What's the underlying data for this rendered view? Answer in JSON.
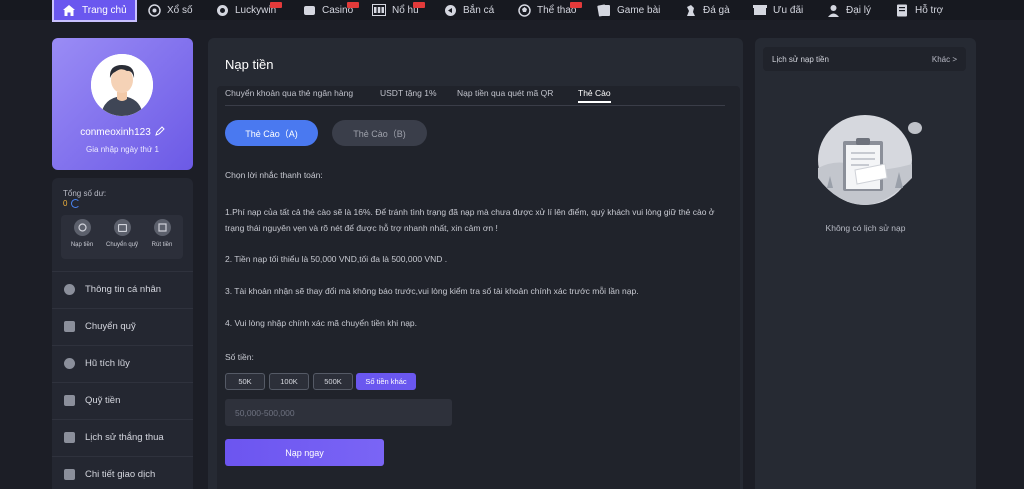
{
  "nav": {
    "items": [
      {
        "label": "Trang chủ",
        "icon": "home-icon",
        "active": true
      },
      {
        "label": "Xổ số",
        "icon": "lottery-icon"
      },
      {
        "label": "Luckywin",
        "icon": "luckywin-icon",
        "badge": true
      },
      {
        "label": "Casino",
        "icon": "casino-icon",
        "badge": true
      },
      {
        "label": "Nổ hũ",
        "icon": "slot-icon",
        "badge": true
      },
      {
        "label": "Bắn cá",
        "icon": "fish-icon"
      },
      {
        "label": "Thể thao",
        "icon": "sports-icon",
        "badge": true
      },
      {
        "label": "Game bài",
        "icon": "cards-icon"
      },
      {
        "label": "Đá gà",
        "icon": "rooster-icon"
      },
      {
        "label": "Ưu đãi",
        "icon": "gift-icon"
      },
      {
        "label": "Đại lý",
        "icon": "agent-icon"
      },
      {
        "label": "Hỗ trợ",
        "icon": "support-icon"
      }
    ]
  },
  "profile": {
    "username": "conmeoxinh123",
    "join_text": "Gia nhập ngày thứ 1"
  },
  "sidebar": {
    "balance_label": "Tổng số dư:",
    "balance_value": "0",
    "quick": [
      {
        "label": "Nạp tiền",
        "icon": "deposit-icon"
      },
      {
        "label": "Chuyển quỹ",
        "icon": "transfer-icon"
      },
      {
        "label": "Rút tiền",
        "icon": "withdraw-icon"
      }
    ],
    "menu": [
      {
        "label": "Thông tin cá nhân",
        "icon": "user-icon"
      },
      {
        "label": "Chuyển quỹ",
        "icon": "wallet-icon"
      },
      {
        "label": "Hũ tích lũy",
        "icon": "jar-icon"
      },
      {
        "label": "Quỹ tiền",
        "icon": "fund-icon"
      },
      {
        "label": "Lịch sử thắng thua",
        "icon": "history-icon"
      },
      {
        "label": "Chi tiết giao dịch",
        "icon": "receipt-icon"
      }
    ]
  },
  "main": {
    "title": "Nạp tiền",
    "tabs": [
      {
        "label": "Chuyển khoản qua thẻ ngân hàng"
      },
      {
        "label": "USDT tặng 1%"
      },
      {
        "label": "Nạp tiền qua quét mã QR"
      },
      {
        "label": "Thẻ Cào",
        "active": true
      }
    ],
    "subtabs": {
      "a": "Thẻ Cào（A)",
      "b": "Thẻ Cào（B)"
    },
    "notes": {
      "heading": "Chọn lời nhắc thanh toán:",
      "n1": "1.Phí nạp của tất cả thẻ cào sẽ là 16%. Để tránh tình trạng đã nạp mà chưa được xử lí lên điểm, quý khách vui lòng giữ thẻ cào ở trạng thái nguyên vẹn và rõ nét  để được hỗ trợ nhanh nhất, xin cảm ơn !",
      "n2": "2. Tiền nạp tối thiểu là 50,000 VND,tối đa là 500,000 VND .",
      "n3": "3. Tài khoản nhận sẽ thay đổi mà không báo trước,vui lòng kiểm tra số tài khoản chính xác trước mỗi lần nạp.",
      "n4": "4. Vui lòng nhập chính xác mã chuyển tiền khi nạp."
    },
    "amount_label": "Số tiền:",
    "amounts": [
      "50K",
      "100K",
      "500K",
      "Số tiền khác"
    ],
    "amount_placeholder": "50,000-500,000",
    "submit_label": "Nạp ngay"
  },
  "history": {
    "title": "Lịch sử nạp tiền",
    "more": "Khác >",
    "empty_text": "Không có lịch sử nạp"
  },
  "colors": {
    "accent": "#6a57ef",
    "blue": "#4a79f0",
    "gold": "#f1b43d"
  }
}
